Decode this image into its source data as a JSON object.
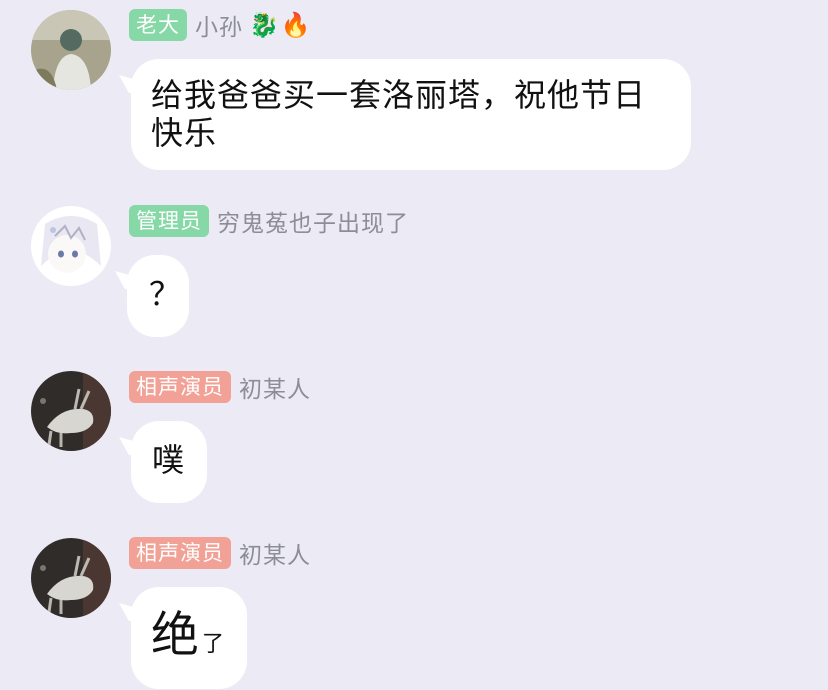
{
  "messages": [
    {
      "badge": "老大",
      "badge_color": "#86d8a6",
      "sender": "小孙",
      "sender_emoji": [
        "🐉",
        "🔥"
      ],
      "avatar": "avatar-photo-girl-outdoor",
      "text": "给我爸爸买一套洛丽塔，祝他节日快乐"
    },
    {
      "badge": "管理员",
      "badge_color": "#86d8a6",
      "sender": "穷鬼菟也子出现了",
      "avatar": "avatar-anime-girl",
      "text": "？"
    },
    {
      "badge": "相声演员",
      "badge_color": "#f2a196",
      "sender": "初某人",
      "avatar": "avatar-white-deer",
      "text": "噗"
    },
    {
      "badge": "相声演员",
      "badge_color": "#f2a196",
      "sender": "初某人",
      "avatar": "avatar-white-deer",
      "text": "绝",
      "text_suffix": "了"
    }
  ]
}
